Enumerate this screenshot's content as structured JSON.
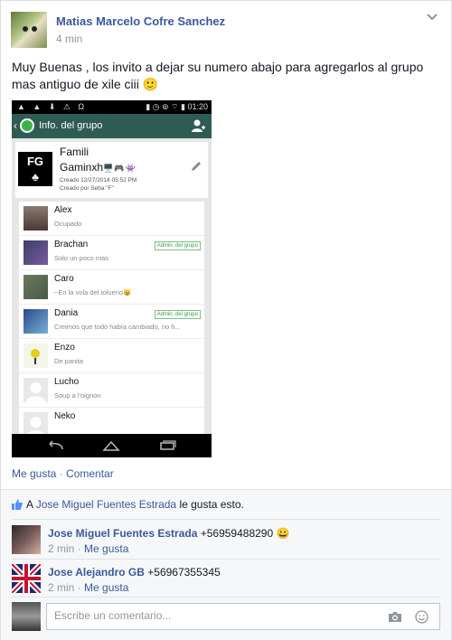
{
  "post": {
    "author": "Matias Marcelo Cofre Sanchez",
    "time": "4 min",
    "text": "Muy Buenas , los invito a dejar su numero abajo para agregarlos al grupo mas antiguo de xile ciii 🙂"
  },
  "screenshot": {
    "status_time": "01:20",
    "wa_title": "Info. del grupo",
    "group": {
      "logo": "FG",
      "name_line1": "Famili",
      "name_line2": "Gaminxh",
      "name_emoji": "🖥️🎮👾",
      "created": "Creado 12/27/2014 05:52 PM",
      "created_by": "Creado por Seba \"F\""
    },
    "members": [
      {
        "name": "Alex",
        "status": "Ocupado",
        "admin": ""
      },
      {
        "name": "Brachan",
        "status": "Solo un poco mas",
        "admin": "Admin. del grupo"
      },
      {
        "name": "Caro",
        "status": "~En la vola del tolueno😸",
        "admin": ""
      },
      {
        "name": "Dania",
        "status": "Creimos que todo había cambiado, no h...",
        "admin": "Admin. del grupo"
      },
      {
        "name": "Enzo",
        "status": "De panita",
        "admin": ""
      },
      {
        "name": "Lucho",
        "status": "Soup a l'oignon",
        "admin": ""
      },
      {
        "name": "Neko",
        "status": "",
        "admin": ""
      }
    ]
  },
  "actions": {
    "like": "Me gusta",
    "separator": " · ",
    "comment": "Comentar"
  },
  "likes": {
    "prefix": "A ",
    "name": "Jose Miguel Fuentes Estrada",
    "suffix": " le gusta esto."
  },
  "comments": [
    {
      "author": "Jose Miguel Fuentes Estrada",
      "text": " +56959488290 😀",
      "time": "2 min",
      "like": "Me gusta"
    },
    {
      "author": "Jose Alejandro GB",
      "text": " +56967355345",
      "time": "2 min",
      "like": "Me gusta"
    }
  ],
  "comment_box": {
    "placeholder": "Escribe un comentario..."
  },
  "colors": {
    "link": "#3b5998",
    "meta": "#9197a3",
    "whatsapp_bar": "#2e5c55"
  }
}
